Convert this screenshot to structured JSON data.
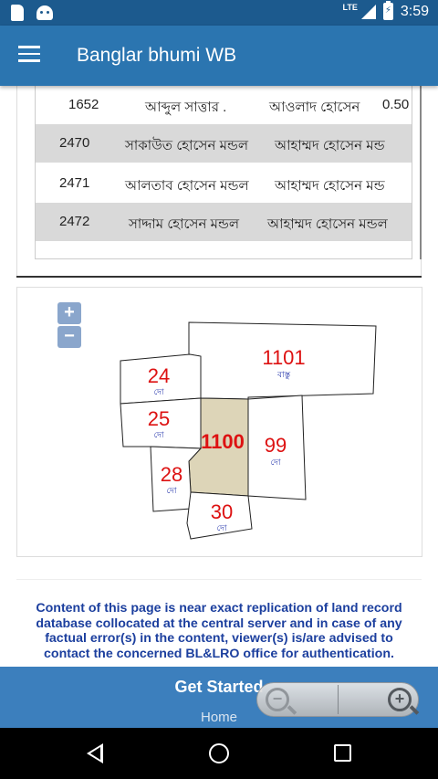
{
  "status_bar": {
    "network": "LTE",
    "time": "3:59"
  },
  "app_bar": {
    "title": "Banglar bhumi WB"
  },
  "table": {
    "rows": [
      {
        "khatian": "1652",
        "owner": "আব্দুল সাত্তার .",
        "father": "আওলাদ হোসেন",
        "share": "0.50"
      },
      {
        "khatian": "2470",
        "owner": "সাকাউত হোসেন মন্ডল",
        "father": "আহাম্মদ হোসেন মন্ড",
        "share": ""
      },
      {
        "khatian": "2471",
        "owner": "আলতাব হোসেন মন্ডল",
        "father": "আহাম্মদ হোসেন মন্ড",
        "share": ""
      },
      {
        "khatian": "2472",
        "owner": "সাদ্দাম হোসেন মন্ডল",
        "father": "আহাম্মদ হোসেন মন্ডল",
        "share": ""
      }
    ]
  },
  "map": {
    "zoom_in_label": "+",
    "zoom_out_label": "−",
    "plots": [
      {
        "number": "1101",
        "land_type": "বাস্তু",
        "selected": false
      },
      {
        "number": "24",
        "land_type": "দো",
        "selected": false
      },
      {
        "number": "25",
        "land_type": "দো",
        "selected": false
      },
      {
        "number": "1100",
        "land_type": "",
        "selected": true
      },
      {
        "number": "99",
        "land_type": "দো",
        "selected": false
      },
      {
        "number": "28",
        "land_type": "দো",
        "selected": false
      },
      {
        "number": "30",
        "land_type": "দো",
        "selected": false
      }
    ],
    "selected_fill": "#ddd5b8",
    "label_color": "#dd1111"
  },
  "disclaimer": {
    "lines": [
      "Content of this page is near exact replication of land record",
      "database collocated at the central server and in case of any",
      "factual error(s) in the content, viewer(s) is/are advised to",
      "contact the concerned BL&LRO office for authentication."
    ]
  },
  "bottom_panel": {
    "get_started": "Get Started",
    "home": "Home"
  },
  "icons": [
    "menu-icon",
    "sd-card-icon",
    "android-icon",
    "signal-icon",
    "battery-icon",
    "zoom-in-icon",
    "zoom-out-icon",
    "back-icon",
    "home-icon",
    "recents-icon"
  ],
  "colors": {
    "status_bar": "#1c5a8e",
    "app_bar": "#2b75b0",
    "disclaimer_text": "#1c3f9e",
    "bottom_panel": "#3c7fbd"
  }
}
